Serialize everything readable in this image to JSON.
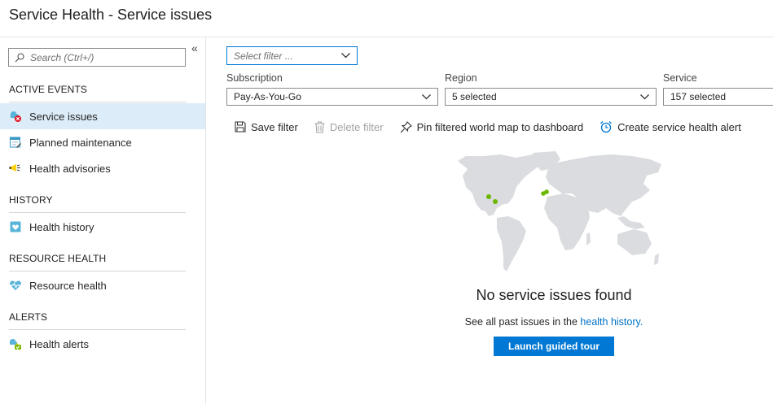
{
  "window": {
    "title": "Service Health - Service issues"
  },
  "sidebar": {
    "collapse_glyph": "«",
    "search": {
      "placeholder": "Search (Ctrl+/)",
      "icon": "search-icon"
    },
    "sections": [
      {
        "heading": "ACTIVE EVENTS",
        "items": [
          {
            "label": "Service issues",
            "icon": "service-issues-icon",
            "active": true
          },
          {
            "label": "Planned maintenance",
            "icon": "planned-maintenance-icon",
            "active": false
          },
          {
            "label": "Health advisories",
            "icon": "health-advisories-icon",
            "active": false
          }
        ]
      },
      {
        "heading": "HISTORY",
        "items": [
          {
            "label": "Health history",
            "icon": "health-history-icon",
            "active": false
          }
        ]
      },
      {
        "heading": "RESOURCE HEALTH",
        "items": [
          {
            "label": "Resource health",
            "icon": "resource-health-icon",
            "active": false
          }
        ]
      },
      {
        "heading": "ALERTS",
        "items": [
          {
            "label": "Health alerts",
            "icon": "health-alerts-icon",
            "active": false
          }
        ]
      }
    ]
  },
  "filters": {
    "filter_select": {
      "placeholder": "Select filter ..."
    },
    "subscription": {
      "label": "Subscription",
      "value": "Pay-As-You-Go"
    },
    "region": {
      "label": "Region",
      "value": "5 selected"
    },
    "service": {
      "label": "Service",
      "value": "157 selected"
    }
  },
  "toolbar": {
    "save": "Save filter",
    "delete": "Delete filter",
    "pin": "Pin filtered world map to dashboard",
    "alert": "Create service health alert"
  },
  "empty_state": {
    "title": "No service issues found",
    "subtitle_prefix": "See all past issues in the ",
    "link": "health history.",
    "button": "Launch guided tour"
  },
  "colors": {
    "accent": "#0078d4",
    "active_nav": "#dcecf9",
    "map_land": "#dadcdf",
    "map_dot": "#6bb700"
  }
}
